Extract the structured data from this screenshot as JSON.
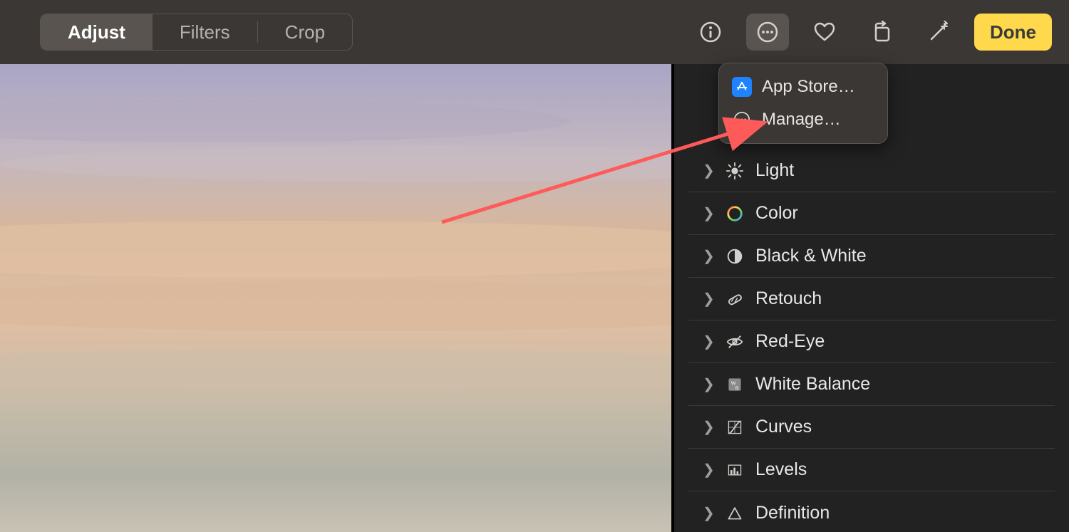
{
  "toolbar": {
    "tabs": [
      {
        "label": "Adjust",
        "active": true
      },
      {
        "label": "Filters",
        "active": false
      },
      {
        "label": "Crop",
        "active": false
      }
    ],
    "done_label": "Done",
    "icons": {
      "info": "info-icon",
      "more": "more-icon",
      "favorite": "heart-icon",
      "rotate": "rotate-icon",
      "wand": "wand-icon"
    }
  },
  "popover": {
    "items": [
      {
        "label": "App Store…",
        "icon": "appstore-icon"
      },
      {
        "label": "Manage…",
        "icon": "more-circle-icon"
      }
    ]
  },
  "sidebar": {
    "rows": [
      {
        "label": "Light",
        "icon": "light-icon"
      },
      {
        "label": "Color",
        "icon": "color-icon"
      },
      {
        "label": "Black & White",
        "icon": "bw-icon"
      },
      {
        "label": "Retouch",
        "icon": "retouch-icon"
      },
      {
        "label": "Red-Eye",
        "icon": "redeye-icon"
      },
      {
        "label": "White Balance",
        "icon": "white-balance-icon"
      },
      {
        "label": "Curves",
        "icon": "curves-icon"
      },
      {
        "label": "Levels",
        "icon": "levels-icon"
      },
      {
        "label": "Definition",
        "icon": "definition-icon"
      }
    ]
  },
  "annotation": {
    "type": "arrow",
    "color": "#ff5a5a"
  }
}
